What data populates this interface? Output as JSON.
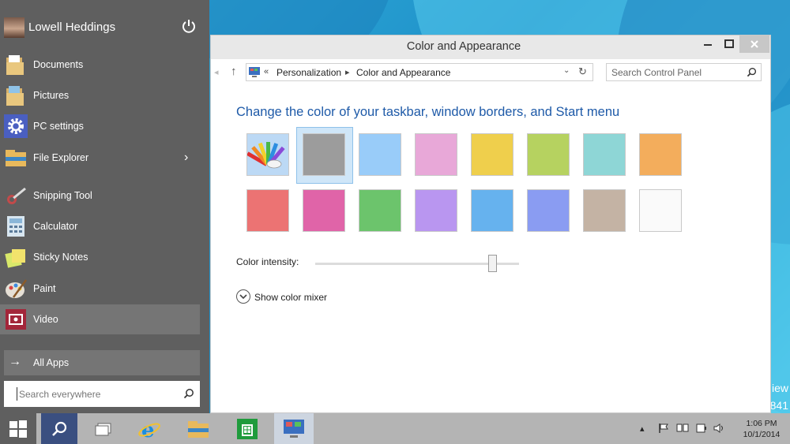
{
  "desktop": {
    "partial_text_1": "iew",
    "partial_text_2": "841"
  },
  "start_menu": {
    "user": {
      "name": "Lowell Heddings"
    },
    "items": [
      {
        "label": "Documents",
        "icon": "folder-documents-icon"
      },
      {
        "label": "Pictures",
        "icon": "folder-pictures-icon"
      },
      {
        "label": "PC settings",
        "icon": "gear-icon"
      },
      {
        "label": "File Explorer",
        "icon": "file-explorer-icon",
        "has_submenu": true
      },
      {
        "label": "Snipping Tool",
        "icon": "scissors-icon"
      },
      {
        "label": "Calculator",
        "icon": "calculator-icon"
      },
      {
        "label": "Sticky Notes",
        "icon": "sticky-notes-icon"
      },
      {
        "label": "Paint",
        "icon": "paint-palette-icon"
      },
      {
        "label": "Video",
        "icon": "video-icon",
        "highlighted": true
      }
    ],
    "all_apps_label": "All Apps",
    "search_placeholder": "Search everywhere"
  },
  "window": {
    "title": "Color and Appearance",
    "breadcrumb": [
      "Personalization",
      "Color and Appearance"
    ],
    "breadcrumb_prefix": "«",
    "search_placeholder": "Search Control Panel",
    "heading": "Change the color of your taskbar, window borders, and Start menu",
    "swatches": [
      {
        "color": "automatic",
        "kind": "palette"
      },
      {
        "color": "#9c9c9c",
        "selected": true
      },
      {
        "color": "#99ccf9"
      },
      {
        "color": "#e8a8d8"
      },
      {
        "color": "#efcf4c"
      },
      {
        "color": "#b6d260"
      },
      {
        "color": "#8ed6d6"
      },
      {
        "color": "#f3ad5c"
      },
      {
        "color": "#ec7373"
      },
      {
        "color": "#e064a8"
      },
      {
        "color": "#6cc46c"
      },
      {
        "color": "#b996f0"
      },
      {
        "color": "#66b2ee"
      },
      {
        "color": "#8a9cf2"
      },
      {
        "color": "#c4b3a4"
      },
      {
        "color": "#fafafa"
      }
    ],
    "intensity": {
      "label": "Color intensity:",
      "value_fraction": 0.87
    },
    "mixer_label": "Show color mixer"
  },
  "taskbar": {
    "apps": [
      "windows-start-icon",
      "search-icon",
      "task-view-icon",
      "internet-explorer-icon",
      "file-explorer-icon",
      "store-icon",
      "control-panel-icon"
    ],
    "clock": {
      "time": "1:06 PM",
      "date": "10/1/2014"
    }
  }
}
